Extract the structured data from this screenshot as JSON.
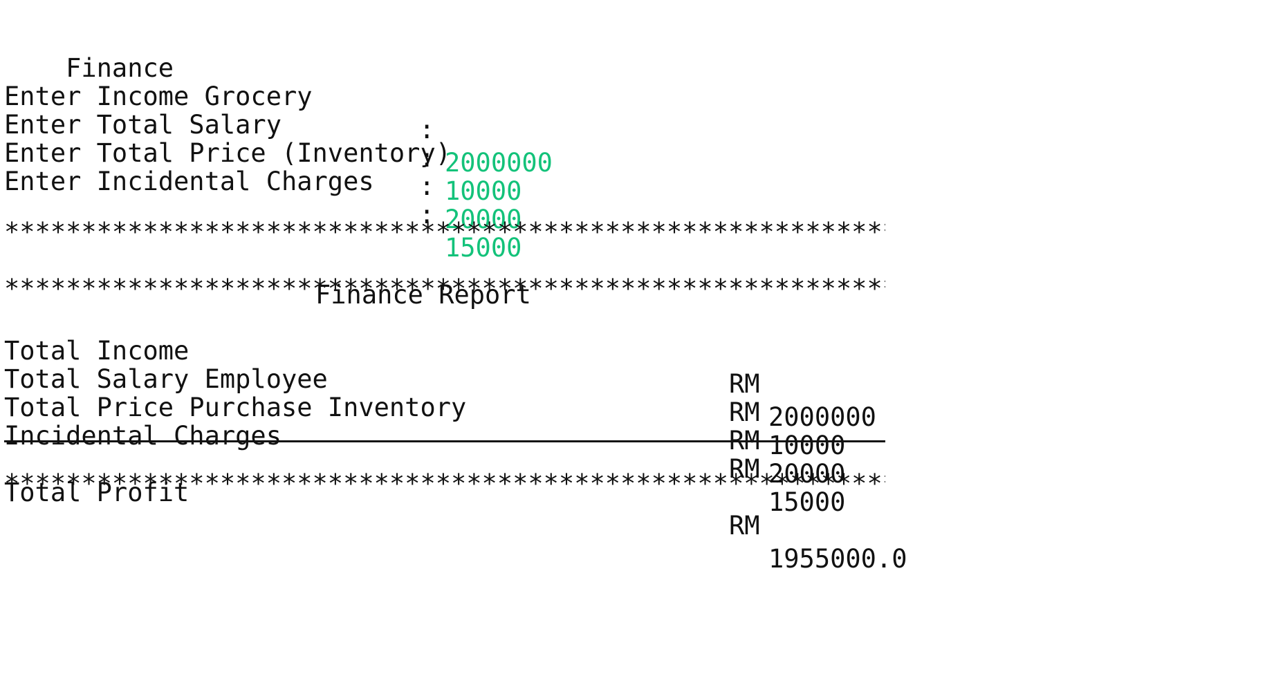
{
  "header": {
    "title": "Finance"
  },
  "inputs": [
    {
      "label": "Enter Income Grocery",
      "separator": ":",
      "value": "2000000"
    },
    {
      "label": "Enter Total Salary",
      "separator": ":",
      "value": "10000"
    },
    {
      "label": "Enter Total Price (Inventory)",
      "separator": ":",
      "value": "20000"
    },
    {
      "label": "Enter Incidental Charges",
      "separator": ":",
      "value": "15000"
    }
  ],
  "colors": {
    "input_value": "#13c27a",
    "text": "#111111",
    "background": "#ffffff"
  },
  "report": {
    "border": "*********************************************************************",
    "title": "Finance Report",
    "rows": [
      {
        "label": "Total Income",
        "currency": "RM",
        "amount": "2000000"
      },
      {
        "label": "Total Salary Employee",
        "currency": "RM",
        "amount": "10000"
      },
      {
        "label": "Total Price Purchase Inventory",
        "currency": "RM",
        "amount": "20000"
      },
      {
        "label": "Incidental Charges",
        "currency": "RM",
        "amount": "15000"
      }
    ],
    "total": {
      "label": "Total Profit",
      "currency": "RM",
      "amount": "1955000.0"
    }
  }
}
